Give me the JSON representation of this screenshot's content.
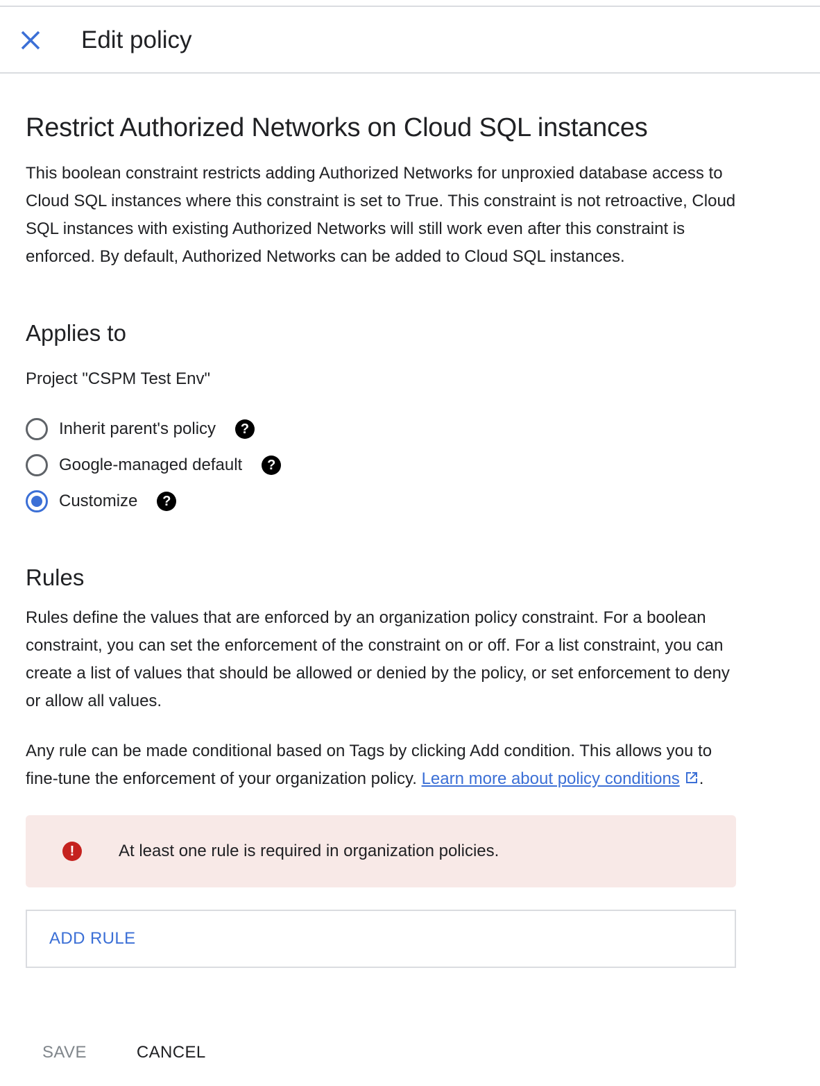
{
  "header": {
    "title": "Edit policy",
    "close_icon": "close-icon"
  },
  "policy": {
    "title": "Restrict Authorized Networks on Cloud SQL instances",
    "description": "This boolean constraint restricts adding Authorized Networks for unproxied database access to Cloud SQL instances where this constraint is set to True. This constraint is not retroactive, Cloud SQL instances with existing Authorized Networks will still work even after this constraint is enforced. By default, Authorized Networks can be added to Cloud SQL instances."
  },
  "applies_to": {
    "heading": "Applies to",
    "project": "Project \"CSPM Test Env\"",
    "options": [
      {
        "label": "Inherit parent's policy",
        "checked": false
      },
      {
        "label": "Google-managed default",
        "checked": false
      },
      {
        "label": "Customize",
        "checked": true
      }
    ],
    "help_glyph": "?"
  },
  "rules": {
    "heading": "Rules",
    "para1": "Rules define the values that are enforced by an organization policy constraint. For a boolean constraint, you can set the enforcement of the constraint on or off. For a list constraint, you can create a list of values that should be allowed or denied by the policy, or set enforcement to deny or allow all values.",
    "para2_text": "Any rule can be made conditional based on Tags by clicking Add condition. This allows you to fine-tune the enforcement of your organization policy. ",
    "para2_link": "Learn more about policy conditions",
    "para2_end": ".",
    "error_glyph": "!",
    "error_message": "At least one rule is required in organization policies.",
    "add_rule_label": "ADD RULE"
  },
  "footer": {
    "save_label": "SAVE",
    "cancel_label": "CANCEL"
  },
  "colors": {
    "accent": "#3b6fd6",
    "error": "#c5221f",
    "error_bg": "#f8e9e7",
    "disabled": "#80868b"
  }
}
